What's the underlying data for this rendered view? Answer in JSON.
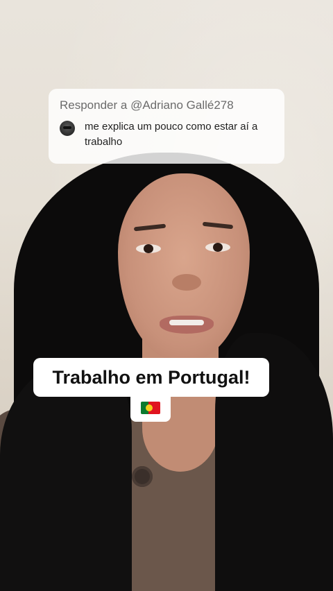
{
  "reply": {
    "title": "Responder a @Adriano Gallé278",
    "comment": "me explica um pouco como estar aí a trabalho",
    "avatar_icon": "user-avatar"
  },
  "caption": {
    "text": "Trabalho em Portugal!",
    "flag_icon": "portugal-flag-icon"
  }
}
